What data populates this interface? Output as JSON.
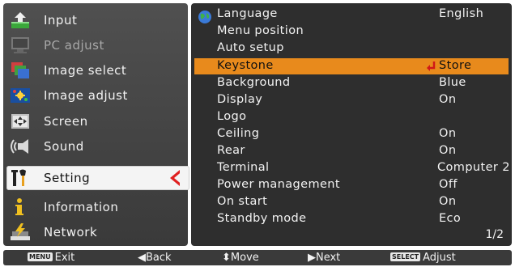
{
  "left_menu": [
    {
      "label": "Input",
      "icon": "input-icon"
    },
    {
      "label": "PC adjust",
      "icon": "pc-adjust-icon"
    },
    {
      "label": "Image select",
      "icon": "image-select-icon"
    },
    {
      "label": "Image adjust",
      "icon": "image-adjust-icon"
    },
    {
      "label": "Screen",
      "icon": "screen-icon"
    },
    {
      "label": "Sound",
      "icon": "sound-icon"
    },
    {
      "label": "Setting",
      "icon": "setting-icon"
    },
    {
      "label": "Information",
      "icon": "information-icon"
    },
    {
      "label": "Network",
      "icon": "network-icon"
    }
  ],
  "settings": [
    {
      "label": "Language",
      "value": "English"
    },
    {
      "label": "Menu position",
      "value": ""
    },
    {
      "label": "Auto setup",
      "value": ""
    },
    {
      "label": "Keystone",
      "value": "Store"
    },
    {
      "label": "Background",
      "value": "Blue"
    },
    {
      "label": "Display",
      "value": "On"
    },
    {
      "label": "Logo",
      "value": ""
    },
    {
      "label": "Ceiling",
      "value": "On"
    },
    {
      "label": "Rear",
      "value": "On"
    },
    {
      "label": "Terminal",
      "value": "Computer 2"
    },
    {
      "label": "Power management",
      "value": "Off"
    },
    {
      "label": "On start",
      "value": "On"
    },
    {
      "label": "Standby mode",
      "value": "Eco"
    }
  ],
  "page_indicator": "1/2",
  "footer": {
    "menu_badge": "MENU",
    "exit": "Exit",
    "back": "◀Back",
    "move": "⬍Move",
    "next": "▶Next",
    "select_badge": "SELECT",
    "adjust": "Adjust"
  },
  "colors": {
    "highlight": "#e88a1c",
    "selected_arrow": "#e02020",
    "panel": "#2e2e2e"
  }
}
